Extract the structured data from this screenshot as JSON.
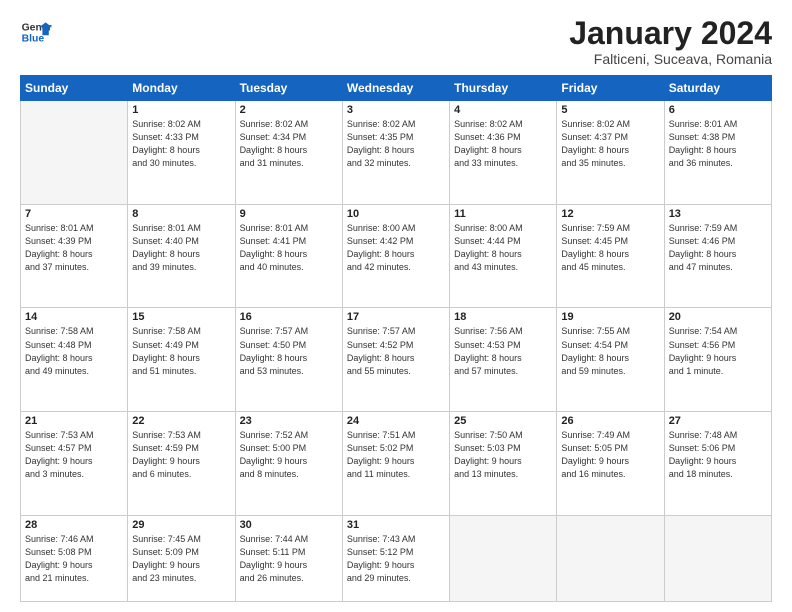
{
  "logo": {
    "line1": "General",
    "line2": "Blue"
  },
  "title": "January 2024",
  "subtitle": "Falticeni, Suceava, Romania",
  "days_of_week": [
    "Sunday",
    "Monday",
    "Tuesday",
    "Wednesday",
    "Thursday",
    "Friday",
    "Saturday"
  ],
  "weeks": [
    [
      {
        "num": "",
        "info": ""
      },
      {
        "num": "1",
        "info": "Sunrise: 8:02 AM\nSunset: 4:33 PM\nDaylight: 8 hours\nand 30 minutes."
      },
      {
        "num": "2",
        "info": "Sunrise: 8:02 AM\nSunset: 4:34 PM\nDaylight: 8 hours\nand 31 minutes."
      },
      {
        "num": "3",
        "info": "Sunrise: 8:02 AM\nSunset: 4:35 PM\nDaylight: 8 hours\nand 32 minutes."
      },
      {
        "num": "4",
        "info": "Sunrise: 8:02 AM\nSunset: 4:36 PM\nDaylight: 8 hours\nand 33 minutes."
      },
      {
        "num": "5",
        "info": "Sunrise: 8:02 AM\nSunset: 4:37 PM\nDaylight: 8 hours\nand 35 minutes."
      },
      {
        "num": "6",
        "info": "Sunrise: 8:01 AM\nSunset: 4:38 PM\nDaylight: 8 hours\nand 36 minutes."
      }
    ],
    [
      {
        "num": "7",
        "info": "Sunrise: 8:01 AM\nSunset: 4:39 PM\nDaylight: 8 hours\nand 37 minutes."
      },
      {
        "num": "8",
        "info": "Sunrise: 8:01 AM\nSunset: 4:40 PM\nDaylight: 8 hours\nand 39 minutes."
      },
      {
        "num": "9",
        "info": "Sunrise: 8:01 AM\nSunset: 4:41 PM\nDaylight: 8 hours\nand 40 minutes."
      },
      {
        "num": "10",
        "info": "Sunrise: 8:00 AM\nSunset: 4:42 PM\nDaylight: 8 hours\nand 42 minutes."
      },
      {
        "num": "11",
        "info": "Sunrise: 8:00 AM\nSunset: 4:44 PM\nDaylight: 8 hours\nand 43 minutes."
      },
      {
        "num": "12",
        "info": "Sunrise: 7:59 AM\nSunset: 4:45 PM\nDaylight: 8 hours\nand 45 minutes."
      },
      {
        "num": "13",
        "info": "Sunrise: 7:59 AM\nSunset: 4:46 PM\nDaylight: 8 hours\nand 47 minutes."
      }
    ],
    [
      {
        "num": "14",
        "info": "Sunrise: 7:58 AM\nSunset: 4:48 PM\nDaylight: 8 hours\nand 49 minutes."
      },
      {
        "num": "15",
        "info": "Sunrise: 7:58 AM\nSunset: 4:49 PM\nDaylight: 8 hours\nand 51 minutes."
      },
      {
        "num": "16",
        "info": "Sunrise: 7:57 AM\nSunset: 4:50 PM\nDaylight: 8 hours\nand 53 minutes."
      },
      {
        "num": "17",
        "info": "Sunrise: 7:57 AM\nSunset: 4:52 PM\nDaylight: 8 hours\nand 55 minutes."
      },
      {
        "num": "18",
        "info": "Sunrise: 7:56 AM\nSunset: 4:53 PM\nDaylight: 8 hours\nand 57 minutes."
      },
      {
        "num": "19",
        "info": "Sunrise: 7:55 AM\nSunset: 4:54 PM\nDaylight: 8 hours\nand 59 minutes."
      },
      {
        "num": "20",
        "info": "Sunrise: 7:54 AM\nSunset: 4:56 PM\nDaylight: 9 hours\nand 1 minute."
      }
    ],
    [
      {
        "num": "21",
        "info": "Sunrise: 7:53 AM\nSunset: 4:57 PM\nDaylight: 9 hours\nand 3 minutes."
      },
      {
        "num": "22",
        "info": "Sunrise: 7:53 AM\nSunset: 4:59 PM\nDaylight: 9 hours\nand 6 minutes."
      },
      {
        "num": "23",
        "info": "Sunrise: 7:52 AM\nSunset: 5:00 PM\nDaylight: 9 hours\nand 8 minutes."
      },
      {
        "num": "24",
        "info": "Sunrise: 7:51 AM\nSunset: 5:02 PM\nDaylight: 9 hours\nand 11 minutes."
      },
      {
        "num": "25",
        "info": "Sunrise: 7:50 AM\nSunset: 5:03 PM\nDaylight: 9 hours\nand 13 minutes."
      },
      {
        "num": "26",
        "info": "Sunrise: 7:49 AM\nSunset: 5:05 PM\nDaylight: 9 hours\nand 16 minutes."
      },
      {
        "num": "27",
        "info": "Sunrise: 7:48 AM\nSunset: 5:06 PM\nDaylight: 9 hours\nand 18 minutes."
      }
    ],
    [
      {
        "num": "28",
        "info": "Sunrise: 7:46 AM\nSunset: 5:08 PM\nDaylight: 9 hours\nand 21 minutes."
      },
      {
        "num": "29",
        "info": "Sunrise: 7:45 AM\nSunset: 5:09 PM\nDaylight: 9 hours\nand 23 minutes."
      },
      {
        "num": "30",
        "info": "Sunrise: 7:44 AM\nSunset: 5:11 PM\nDaylight: 9 hours\nand 26 minutes."
      },
      {
        "num": "31",
        "info": "Sunrise: 7:43 AM\nSunset: 5:12 PM\nDaylight: 9 hours\nand 29 minutes."
      },
      {
        "num": "",
        "info": ""
      },
      {
        "num": "",
        "info": ""
      },
      {
        "num": "",
        "info": ""
      }
    ]
  ]
}
